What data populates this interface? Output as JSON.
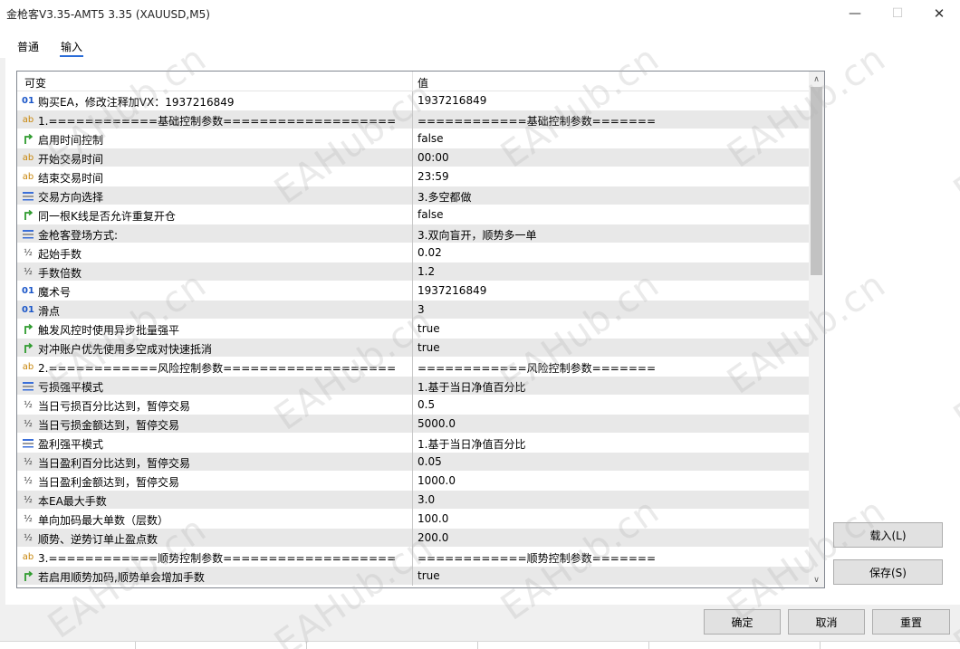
{
  "window": {
    "title": "金枪客V3.35-AMT5 3.35 (XAUUSD,M5)",
    "minimize": "—",
    "maximize": "☐",
    "close": "✕"
  },
  "tabs": [
    {
      "label": "普通",
      "active": false
    },
    {
      "label": "输入",
      "active": true
    }
  ],
  "grid": {
    "header": {
      "col1": "可变",
      "col2": "值"
    },
    "rows": [
      {
        "icon": "int",
        "name": "购买EA，修改注释加VX：1937216849",
        "value": "1937216849"
      },
      {
        "icon": "str",
        "name": "1.============基础控制参数===================",
        "value": "============基础控制参数======="
      },
      {
        "icon": "bool",
        "name": "启用时间控制",
        "value": "false"
      },
      {
        "icon": "str",
        "name": "开始交易时间",
        "value": "00:00"
      },
      {
        "icon": "str",
        "name": "结束交易时间",
        "value": "23:59"
      },
      {
        "icon": "enum",
        "name": "交易方向选择",
        "value": "3.多空都做"
      },
      {
        "icon": "bool",
        "name": "同一根K线是否允许重复开仓",
        "value": "false"
      },
      {
        "icon": "enum",
        "name": "金枪客登场方式:",
        "value": "3.双向盲开，顺势多一单"
      },
      {
        "icon": "dbl",
        "name": "起始手数",
        "value": "0.02"
      },
      {
        "icon": "dbl",
        "name": "手数倍数",
        "value": "1.2"
      },
      {
        "icon": "int",
        "name": "魔术号",
        "value": "1937216849"
      },
      {
        "icon": "int",
        "name": "滑点",
        "value": "3"
      },
      {
        "icon": "bool",
        "name": "触发风控时使用异步批量强平",
        "value": "true"
      },
      {
        "icon": "bool",
        "name": "对冲账户优先使用多空成对快速抵消",
        "value": "true"
      },
      {
        "icon": "str",
        "name": "2.============风险控制参数===================",
        "value": "============风险控制参数======="
      },
      {
        "icon": "enum",
        "name": "亏损强平模式",
        "value": "1.基于当日净值百分比"
      },
      {
        "icon": "dbl",
        "name": "当日亏损百分比达到，暂停交易",
        "value": "0.5"
      },
      {
        "icon": "dbl",
        "name": "当日亏损金额达到，暂停交易",
        "value": "5000.0"
      },
      {
        "icon": "enum",
        "name": "盈利强平模式",
        "value": "1.基于当日净值百分比"
      },
      {
        "icon": "dbl",
        "name": "当日盈利百分比达到，暂停交易",
        "value": "0.05"
      },
      {
        "icon": "dbl",
        "name": "当日盈利金额达到，暂停交易",
        "value": "1000.0"
      },
      {
        "icon": "dbl",
        "name": "本EA最大手数",
        "value": "3.0"
      },
      {
        "icon": "dbl",
        "name": "单向加码最大单数（层数）",
        "value": "100.0"
      },
      {
        "icon": "dbl",
        "name": "顺势、逆势订单止盈点数",
        "value": "200.0"
      },
      {
        "icon": "str",
        "name": "3.============顺势控制参数===================",
        "value": "============顺势控制参数======="
      },
      {
        "icon": "bool",
        "name": "若启用顺势加码,顺势单会增加手数",
        "value": "true"
      }
    ]
  },
  "scrollbar": {
    "up": "∧",
    "down": "∨"
  },
  "buttons": {
    "load": "载入(L)",
    "save": "保存(S)",
    "ok": "确定",
    "cancel": "取消",
    "reset": "重置"
  },
  "watermark": "EAHub.cn",
  "colors": {
    "accent": "#2a6cd8",
    "bool_icon": "#2e9b2e",
    "enum_icon": "#3b6fd8",
    "int_icon": "#1a56c8",
    "str_icon": "#c8860a"
  }
}
